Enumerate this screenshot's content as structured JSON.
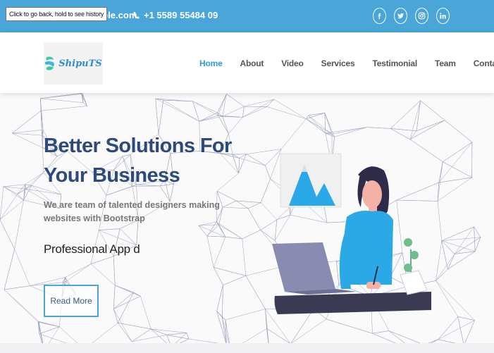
{
  "topbar": {
    "email": "example.com",
    "phone": "+1 5589 55484 09",
    "tooltip": "Click to go back, hold to see history",
    "socials": [
      {
        "icon": "facebook-icon",
        "glyph": "f"
      },
      {
        "icon": "twitter-icon",
        "glyph": "t"
      },
      {
        "icon": "instagram-icon",
        "glyph": "ig"
      },
      {
        "icon": "linkedin-icon",
        "glyph": "in"
      }
    ],
    "bg_color": "#4aa6d9"
  },
  "navbar": {
    "logo_text": "ShipuTS",
    "items": [
      "Home",
      "About",
      "Video",
      "Services",
      "Testimonial",
      "Team",
      "Contact"
    ],
    "active_index": 0,
    "active_color": "#2e9bd8"
  },
  "hero": {
    "title": "Better Solutions For Your Business",
    "subtitle": "We are team of talented designers making websites with Bootstrap",
    "typed_text": "Professional App d",
    "button_label": "Read More",
    "illustration_icon": "person-working-on-laptop-illustration"
  }
}
